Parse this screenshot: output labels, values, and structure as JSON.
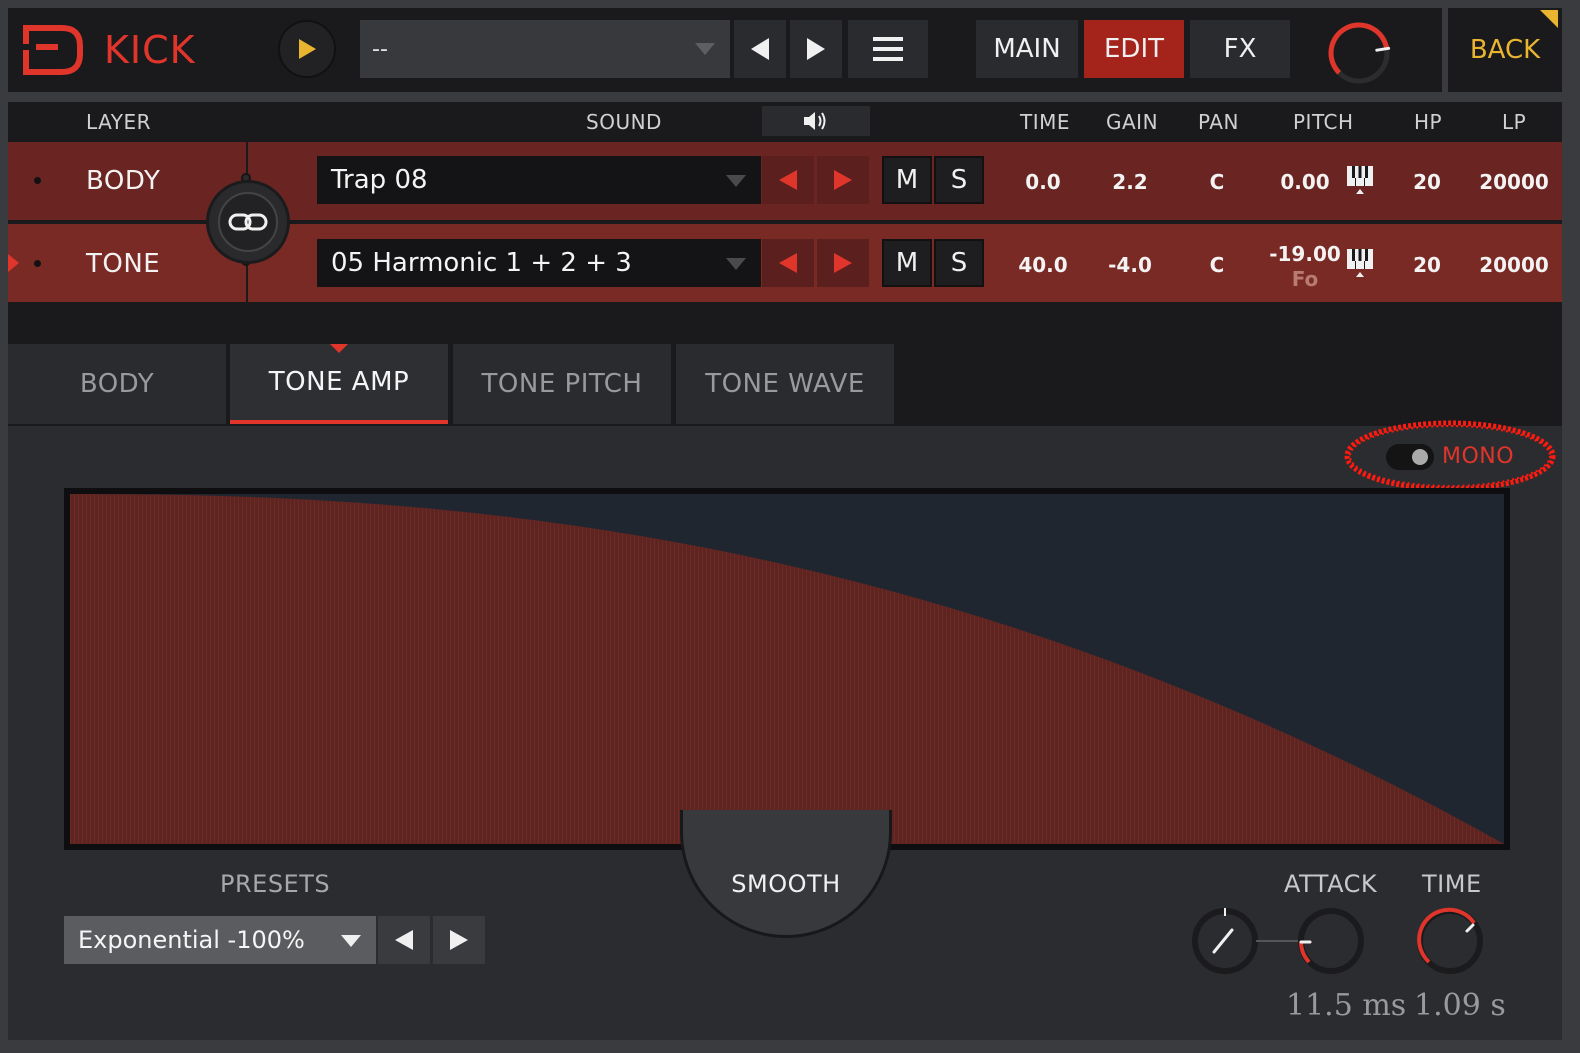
{
  "app": {
    "title": "KICK"
  },
  "toolbar": {
    "preset_value": "--",
    "tabs": [
      {
        "label": "MAIN",
        "active": false
      },
      {
        "label": "EDIT",
        "active": true
      },
      {
        "label": "FX",
        "active": false
      }
    ],
    "back_label": "BACK",
    "master_knob_level": 0.8
  },
  "layer_table": {
    "headers": {
      "layer": "LAYER",
      "sound": "SOUND",
      "time": "TIME",
      "gain": "GAIN",
      "pan": "PAN",
      "pitch": "PITCH",
      "hp": "HP",
      "lp": "LP"
    },
    "rows": [
      {
        "name": "BODY",
        "sound": "Trap 08",
        "mute": "M",
        "solo": "S",
        "time": "0.0",
        "gain": "2.2",
        "pan": "C",
        "pitch": "0.00",
        "pitch_sub": "",
        "hp": "20",
        "lp": "20000",
        "selected": false
      },
      {
        "name": "TONE",
        "sound": "05 Harmonic 1 + 2 + 3",
        "mute": "M",
        "solo": "S",
        "time": "40.0",
        "gain": "-4.0",
        "pan": "C",
        "pitch": "-19.00",
        "pitch_sub": "Fo",
        "hp": "20",
        "lp": "20000",
        "selected": true
      }
    ]
  },
  "sub_tabs": [
    {
      "label": "BODY",
      "active": false
    },
    {
      "label": "TONE AMP",
      "active": true
    },
    {
      "label": "TONE PITCH",
      "active": false
    },
    {
      "label": "TONE WAVE",
      "active": false
    }
  ],
  "editor": {
    "mono_label": "MONO",
    "mono_on": false,
    "smooth_label": "SMOOTH",
    "presets_label": "PRESETS",
    "preset_value": "Exponential -100%",
    "attack_label": "ATTACK",
    "attack_value": "11.5 ms",
    "time_label": "TIME",
    "time_value": "1.09 s"
  },
  "colors": {
    "accent_red": "#e0352b",
    "back_gold": "#e9b531",
    "envelope_fill": "#5e2420",
    "envelope_bg": "#1f2630"
  },
  "icons": {
    "play": "play-icon",
    "prev": "arrow-left-icon",
    "next": "arrow-right-icon",
    "menu": "hamburger-menu-icon",
    "speaker": "speaker-icon",
    "link": "link-icon",
    "piano": "piano-keys-icon",
    "caret": "chevron-down-icon"
  }
}
